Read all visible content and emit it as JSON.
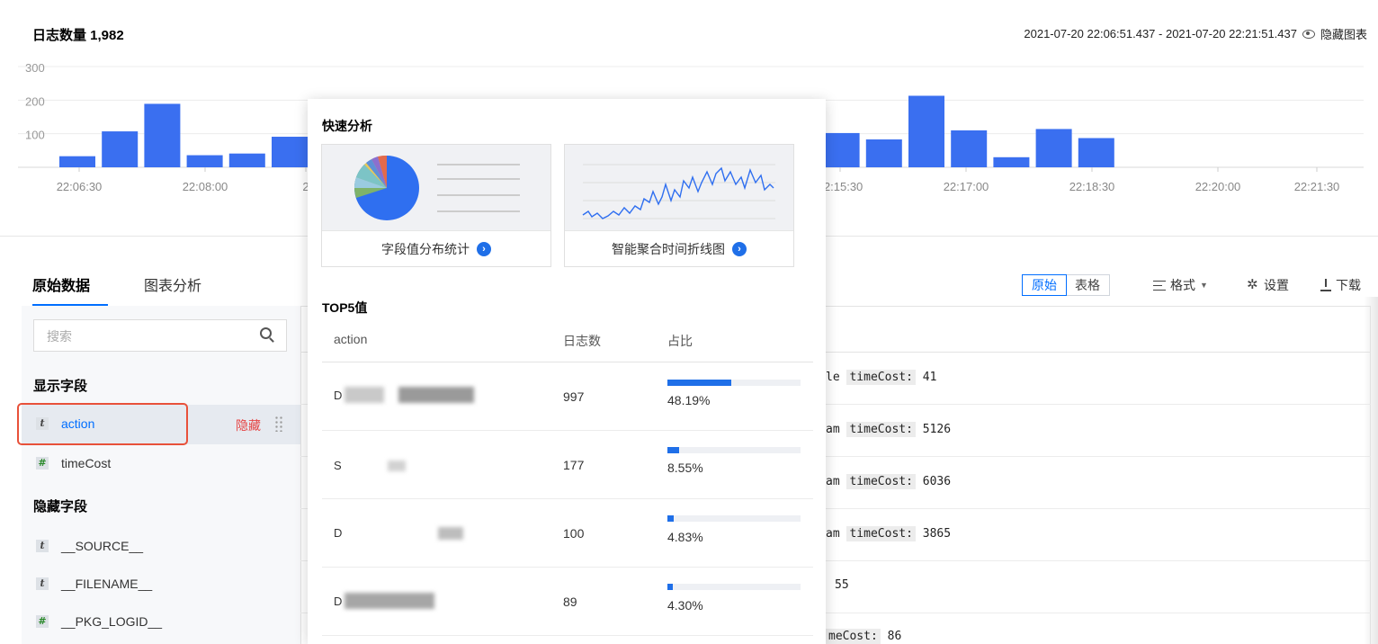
{
  "header": {
    "count_label": "日志数量 1,982",
    "time_range": "2021-07-20 22:06:51.437 - 2021-07-20 22:21:51.437",
    "hide_chart": "隐藏图表"
  },
  "chart_data": {
    "type": "bar",
    "yticks": [
      "300",
      "200",
      "100"
    ],
    "ylim": [
      0,
      300
    ],
    "xticks": [
      "22:06:30",
      "22:08:00",
      "2",
      "22:15:30",
      "22:17:00",
      "22:18:30",
      "22:20:00",
      "22:21:30"
    ],
    "series": [
      {
        "values": [
          33,
          107,
          189,
          36,
          41,
          91,
          0,
          0,
          0,
          0,
          0,
          0,
          0,
          0,
          0,
          0,
          0,
          0,
          102,
          83,
          213,
          110,
          30,
          114,
          87,
          0,
          0,
          0,
          0,
          0,
          0,
          0,
          0
        ]
      }
    ]
  },
  "tabs": {
    "raw": "原始数据",
    "analysis": "图表分析"
  },
  "search": {
    "placeholder": "搜索"
  },
  "fields": {
    "shown_title": "显示字段",
    "hidden_title": "隐藏字段",
    "shown": [
      {
        "type": "t",
        "name": "action",
        "hide": "隐藏"
      },
      {
        "type": "#",
        "name": "timeCost"
      }
    ],
    "hidden": [
      {
        "type": "t",
        "name": "__SOURCE__"
      },
      {
        "type": "t",
        "name": "__FILENAME__"
      },
      {
        "type": "#",
        "name": "__PKG_LOGID__"
      }
    ]
  },
  "toolbar": {
    "raw": "原始",
    "table": "表格",
    "format": "格式",
    "settings": "设置",
    "download": "下载"
  },
  "logs": [
    {
      "prefix": "le",
      "key": "timeCost:",
      "value": "41"
    },
    {
      "prefix": "am",
      "key": "timeCost:",
      "value": "5126"
    },
    {
      "prefix": "am",
      "key": "timeCost:",
      "value": "6036"
    },
    {
      "prefix": "am",
      "key": "timeCost:",
      "value": "3865"
    },
    {
      "prefix": "",
      "key": "",
      "value": "55"
    },
    {
      "prefix": "",
      "key": "meCost:",
      "value": "86"
    }
  ],
  "popover": {
    "title": "快速分析",
    "card1": "字段值分布统计",
    "card2": "智能聚合时间折线图",
    "top5_title": "TOP5值",
    "col_field": "action",
    "col_count": "日志数",
    "col_pct": "占比",
    "rows": [
      {
        "first": "D",
        "count": "997",
        "pct": "48.19%",
        "ratio": 0.4819
      },
      {
        "first": "S",
        "count": "177",
        "pct": "8.55%",
        "ratio": 0.0855
      },
      {
        "first": "D",
        "count": "100",
        "pct": "4.83%",
        "ratio": 0.0483
      },
      {
        "first": "D",
        "count": "89",
        "pct": "4.30%",
        "ratio": 0.043
      }
    ]
  },
  "colors": {
    "accent": "#1f6fe8",
    "bar": "#3a6ff0",
    "danger": "#e54545",
    "highlight": "#e8513a"
  }
}
